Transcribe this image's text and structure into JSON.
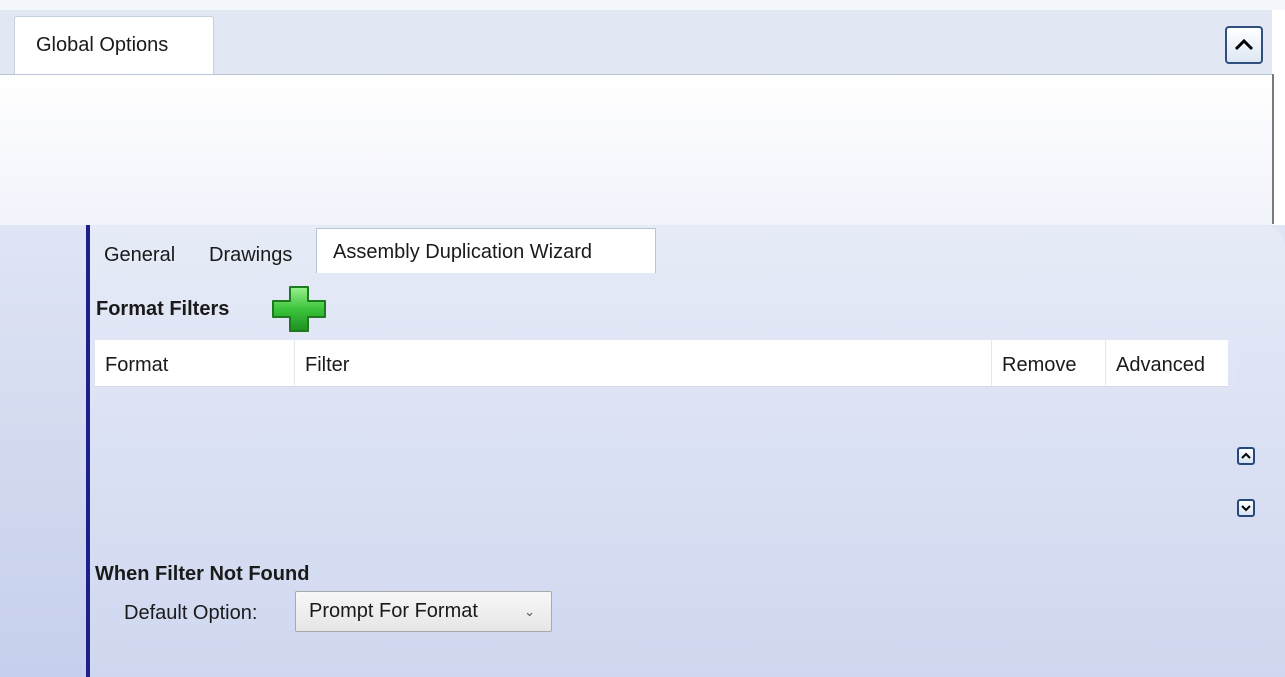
{
  "outer_tabs": {
    "global_options": "Global Options"
  },
  "inner_tabs": {
    "general": "General",
    "drawings": "Drawings",
    "assembly_duplication_wizard": "Assembly Duplication Wizard"
  },
  "format_filters": {
    "title": "Format Filters",
    "columns": [
      "Format",
      "Filter",
      "Remove",
      "Advanced"
    ],
    "rows": []
  },
  "when_filter_not_found": {
    "title": "When Filter Not Found",
    "default_option_label": "Default Option:",
    "default_option_value": "Prompt For Format"
  },
  "icons": {
    "collapse": "chevron-up-icon",
    "add_filter": "green-plus-icon",
    "move_up": "chevron-up-icon",
    "move_down": "chevron-down-icon",
    "dropdown": "chevron-down-icon"
  },
  "colors": {
    "accent_rule": "#1f1f8a",
    "add_icon_green": "#3cc43c",
    "panel_bg": "#dfe5f4"
  }
}
